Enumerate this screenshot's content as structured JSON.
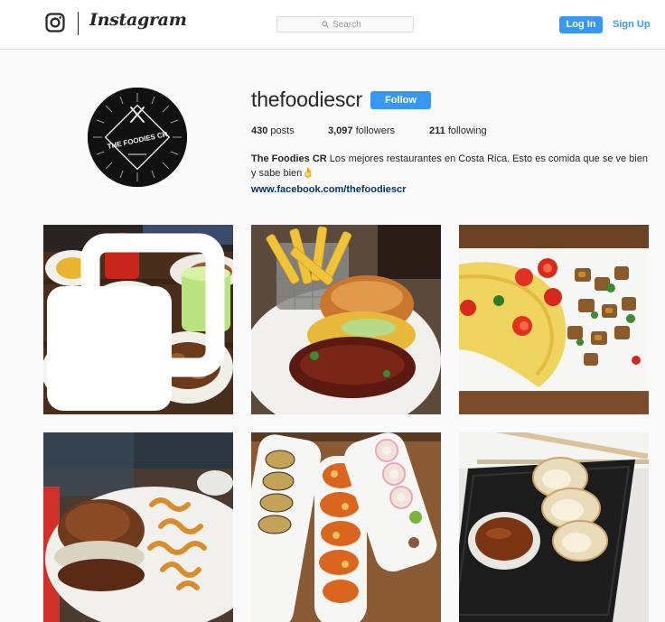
{
  "header": {
    "logo_text": "Instagram",
    "search": {
      "placeholder": "Search"
    },
    "login_label": "Log In",
    "signup_label": "Sign Up",
    "accent": "#3897f0"
  },
  "profile": {
    "username": "thefoodiescr",
    "follow_label": "Follow",
    "avatar_text": "THE FOODIES CR",
    "stats": {
      "posts": {
        "count": "430",
        "label": "posts"
      },
      "followers": {
        "count": "3,097",
        "label": "followers"
      },
      "following": {
        "count": "211",
        "label": "following"
      }
    },
    "bio": {
      "name": "The Foodies CR",
      "text": "Los mejores restaurantes en Costa Rica. Esto es comida que se ve bien y sabe bien",
      "emoji": "👌",
      "link": "www.facebook.com/thefoodiescr"
    }
  },
  "posts": [
    {
      "id": "post-1",
      "icon": "multiple-photos-icon"
    },
    {
      "id": "post-2"
    },
    {
      "id": "post-3"
    },
    {
      "id": "post-4"
    },
    {
      "id": "post-5"
    },
    {
      "id": "post-6"
    }
  ]
}
